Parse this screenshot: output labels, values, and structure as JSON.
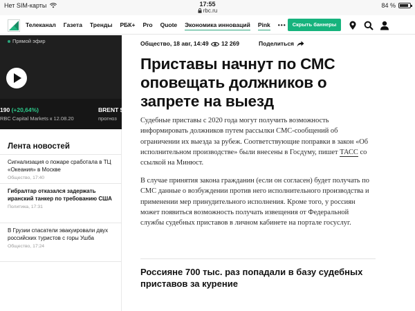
{
  "status_bar": {
    "carrier": "Нет SIM-карты",
    "time": "17:55",
    "url": "rbc.ru",
    "battery_text": "84 %",
    "battery_level": 0.84
  },
  "nav": {
    "links": [
      "Телеканал",
      "Газета",
      "Тренды",
      "РБК+",
      "Pro",
      "Quote",
      "Экономика инноваций",
      "Pink"
    ],
    "more": "•••",
    "banners_button": "Скрыть баннеры",
    "icons": [
      "location-pin-icon",
      "search-icon",
      "user-icon"
    ]
  },
  "left": {
    "live_label": "Прямой эфир",
    "quote1_value": "190",
    "quote1_change": "(+20,64%)",
    "quote1_source": "RBC Capital Markets к 12.08.20",
    "quote2_value": "BRENT $",
    "quote2_source": "прогноз",
    "feed_title": "Лента новостей",
    "feed": [
      {
        "title": "Сигнализация о пожаре сработала в ТЦ «Океания» в Москве",
        "meta": "Общество, 17:40",
        "bold": false
      },
      {
        "title": "Гибралтар отказался задержать иранский танкер по требованию США",
        "meta": "Политика, 17:31",
        "bold": true
      },
      {
        "title": "В Грузии спасатели эвакуировали двух российских туристов с горы Ушба",
        "meta": "Общество, 17:24",
        "bold": false
      }
    ]
  },
  "article": {
    "meta": "Общество, 18 авг, 14:49",
    "views": "12 269",
    "share": "Поделиться",
    "headline": "Приставы начнут по СМС оповещать должников о запрете на выезд",
    "p1_before": "Судебные приставы с 2020 года могут получить возможность информировать должников путем рассылки СМС-сообщений об ограничении их выезда за рубеж. Соответствующие поправки в закон «Об исполнительном производстве» были внесены в Госдуму, пишет ",
    "p1_link": "ТАСС",
    "p1_after": " со ссылкой на Минюст.",
    "p2": "В случае принятия закона гражданин (если он согласен) будет получать по СМС данные о возбуждении против него исполнительного производства и применении мер принудительного исполнения. Кроме того, у россиян может появиться возможность получать извещения от Федеральной службы судебных приставов в личном кабинете на портале госуслуг.",
    "related": "Россияне 700 тыс. раз попадали в базу судебных приставов за курение"
  },
  "colors": {
    "accent_green": "#16b37d",
    "video_bg": "#1f1f1f",
    "quote_up": "#2dc88a"
  }
}
